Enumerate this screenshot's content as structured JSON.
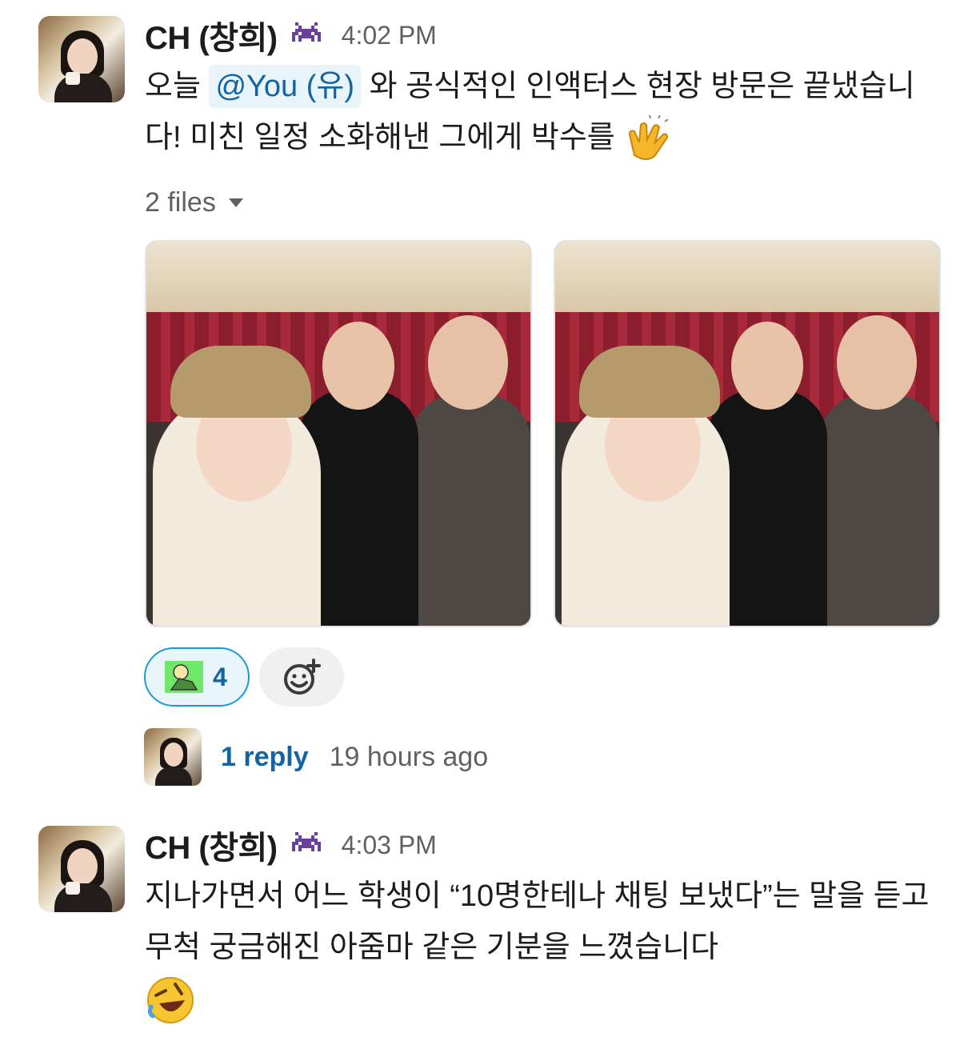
{
  "messages": [
    {
      "author": "CH (창희)",
      "status_icon": "space-invader-icon",
      "time": "4:02 PM",
      "text_before": "오늘",
      "mention": "@You (유)",
      "text_after": "와 공식적인 인액터스 현장 방문은 끝냈습니다! 미친 일정 소화해낸 그에게 박수를",
      "trailing_emoji": "clapping-hands-emoji",
      "files_label": "2 files",
      "reaction": {
        "emoji": "custom-green-emoji",
        "count": "4"
      },
      "thread": {
        "reply_label": "1 reply",
        "time_ago": "19 hours ago"
      }
    },
    {
      "author": "CH (창희)",
      "status_icon": "space-invader-icon",
      "time": "4:03 PM",
      "text": "지나가면서 어느 학생이 “10명한테나 채팅 보냈다”는 말을 듣고 무척 궁금해진 아줌마 같은 기분을 느꼈습니다",
      "trailing_emoji": "rolling-on-floor-laughing-emoji"
    }
  ],
  "colors": {
    "link": "#1264a3",
    "mention_bg": "#e8f3fa",
    "reaction_border": "#1d9bd1",
    "muted_text": "#616061"
  }
}
